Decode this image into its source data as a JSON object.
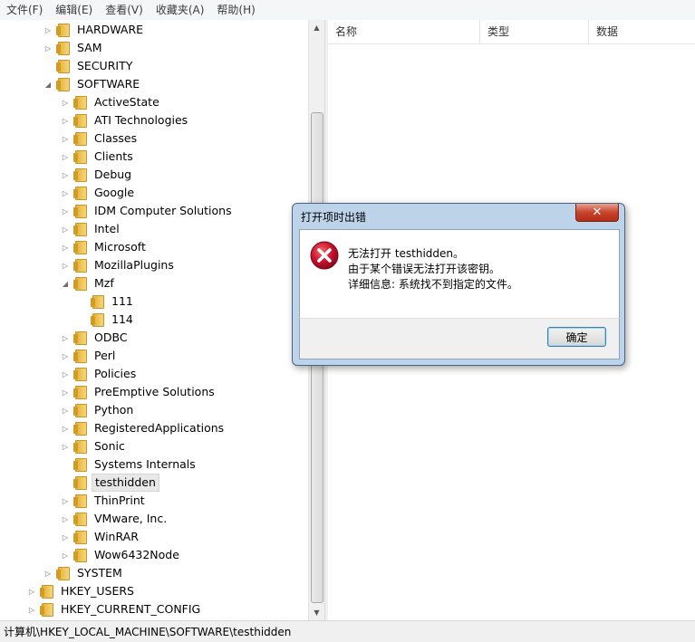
{
  "menu": [
    "文件(F)",
    "编辑(E)",
    "查看(V)",
    "收藏夹(A)",
    "帮助(H)"
  ],
  "tree": [
    {
      "label": "HARDWARE",
      "level": 2,
      "toggle": "collapsed"
    },
    {
      "label": "SAM",
      "level": 2,
      "toggle": "collapsed"
    },
    {
      "label": "SECURITY",
      "level": 2,
      "toggle": "none"
    },
    {
      "label": "SOFTWARE",
      "level": 2,
      "toggle": "expanded"
    },
    {
      "label": "ActiveState",
      "level": 3,
      "toggle": "collapsed"
    },
    {
      "label": "ATI Technologies",
      "level": 3,
      "toggle": "collapsed"
    },
    {
      "label": "Classes",
      "level": 3,
      "toggle": "collapsed"
    },
    {
      "label": "Clients",
      "level": 3,
      "toggle": "collapsed"
    },
    {
      "label": "Debug",
      "level": 3,
      "toggle": "collapsed"
    },
    {
      "label": "Google",
      "level": 3,
      "toggle": "collapsed"
    },
    {
      "label": "IDM Computer Solutions",
      "level": 3,
      "toggle": "collapsed"
    },
    {
      "label": "Intel",
      "level": 3,
      "toggle": "collapsed"
    },
    {
      "label": "Microsoft",
      "level": 3,
      "toggle": "collapsed"
    },
    {
      "label": "MozillaPlugins",
      "level": 3,
      "toggle": "collapsed"
    },
    {
      "label": "Mzf",
      "level": 3,
      "toggle": "expanded"
    },
    {
      "label": "111",
      "level": 4,
      "toggle": "none"
    },
    {
      "label": "114",
      "level": 4,
      "toggle": "none"
    },
    {
      "label": "ODBC",
      "level": 3,
      "toggle": "collapsed"
    },
    {
      "label": "Perl",
      "level": 3,
      "toggle": "collapsed"
    },
    {
      "label": "Policies",
      "level": 3,
      "toggle": "collapsed"
    },
    {
      "label": "PreEmptive Solutions",
      "level": 3,
      "toggle": "collapsed"
    },
    {
      "label": "Python",
      "level": 3,
      "toggle": "collapsed"
    },
    {
      "label": "RegisteredApplications",
      "level": 3,
      "toggle": "collapsed"
    },
    {
      "label": "Sonic",
      "level": 3,
      "toggle": "collapsed"
    },
    {
      "label": "Systems Internals",
      "level": 3,
      "toggle": "none"
    },
    {
      "label": "testhidden",
      "level": 3,
      "toggle": "none",
      "selected": true
    },
    {
      "label": "ThinPrint",
      "level": 3,
      "toggle": "collapsed"
    },
    {
      "label": "VMware, Inc.",
      "level": 3,
      "toggle": "collapsed"
    },
    {
      "label": "WinRAR",
      "level": 3,
      "toggle": "collapsed"
    },
    {
      "label": "Wow6432Node",
      "level": 3,
      "toggle": "collapsed"
    },
    {
      "label": "SYSTEM",
      "level": 2,
      "toggle": "collapsed"
    },
    {
      "label": "HKEY_USERS",
      "level": 1,
      "toggle": "collapsed"
    },
    {
      "label": "HKEY_CURRENT_CONFIG",
      "level": 1,
      "toggle": "collapsed"
    }
  ],
  "columns": [
    "名称",
    "类型",
    "数据"
  ],
  "status": "计算机\\HKEY_LOCAL_MACHINE\\SOFTWARE\\testhidden",
  "dialog": {
    "title": "打开项时出错",
    "lines": [
      "无法打开 testhidden。",
      "由于某个错误无法打开该密钥。",
      "详细信息: 系统找不到指定的文件。"
    ],
    "ok_label": "确定",
    "close_glyph": "✕",
    "icon": "error-icon"
  },
  "colors": {
    "error_red": "#c8102e",
    "dialog_frame": "#bcd3ea"
  }
}
